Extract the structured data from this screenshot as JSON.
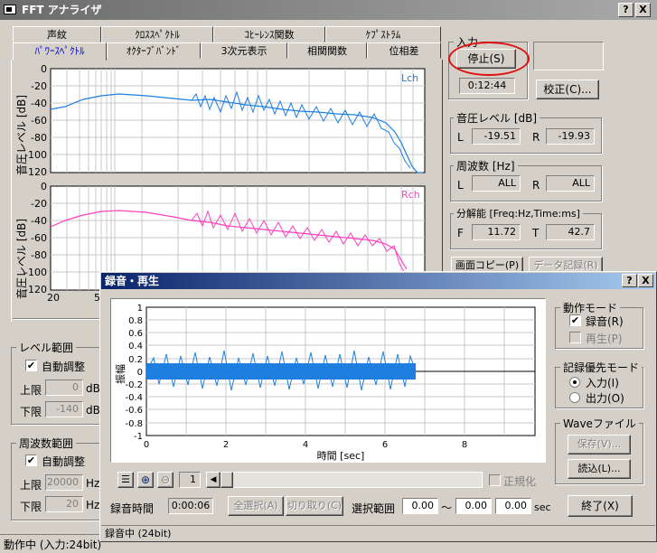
{
  "main_window": {
    "title": "FFT アナライザ",
    "help": "?",
    "close": "X"
  },
  "tabs_row1": [
    "声紋",
    "ｸﾛｽｽﾍﾟｸﾄﾙ",
    "ｺﾋｰﾚﾝｽ関数",
    "ｹﾌﾟｽﾄﾗﾑ"
  ],
  "tabs_row2": [
    "ﾊﾟﾜｰｽﾍﾟｸﾄﾙ",
    "ｵｸﾀｰﾌﾞﾊﾞﾝﾄﾞ",
    "3次元表示",
    "相関関数",
    "位相差"
  ],
  "chart_data": [
    {
      "type": "line",
      "ylabel": "音圧レベル [dB]",
      "yticks": [
        "0",
        "-20",
        "-40",
        "-60",
        "-80",
        "-100",
        "-120"
      ],
      "ylim": [
        -120,
        0
      ],
      "series": [
        {
          "name": "Lch",
          "color": "#1e7fe0"
        }
      ],
      "description_points": [
        [
          20,
          -48
        ],
        [
          60,
          -27
        ],
        [
          500,
          -42
        ],
        [
          5000,
          -48
        ],
        [
          10000,
          -68
        ],
        [
          15000,
          -120
        ]
      ]
    },
    {
      "type": "line",
      "ylabel": "音圧レベル [dB]",
      "yticks": [
        "0",
        "-20",
        "-40",
        "-60",
        "-80",
        "-100",
        "-120"
      ],
      "xticks": [
        "20",
        "5"
      ],
      "ylim": [
        -120,
        0
      ],
      "series": [
        {
          "name": "Rch",
          "color": "#ff40c0"
        }
      ],
      "description_points": [
        [
          20,
          -47
        ],
        [
          60,
          -32
        ],
        [
          500,
          -48
        ],
        [
          5000,
          -60
        ],
        [
          10000,
          -65
        ],
        [
          15000,
          -100
        ]
      ]
    },
    {
      "type": "line",
      "title": "",
      "xlabel": "時間 [sec]",
      "ylabel": "振幅",
      "xticks": [
        "0",
        "2",
        "4",
        "6",
        "8"
      ],
      "yticks": [
        "1",
        "0.8",
        "0.6",
        "0.4",
        "0.2",
        "0",
        "-0.2",
        "-0.4",
        "-0.6",
        "-0.8",
        "-1"
      ],
      "xlim": [
        0,
        10
      ],
      "ylim": [
        -1,
        1
      ],
      "series": [
        {
          "name": "waveform",
          "color": "#1e7fe0",
          "duration_sec": 6.7
        }
      ]
    }
  ],
  "input_panel": {
    "group": "入力",
    "stop_label": "停止(S)",
    "time": "0:12:44",
    "calibrate": "校正(C)..."
  },
  "sound_level": {
    "group": "音圧レベル [dB]",
    "l_label": "L",
    "l_value": "-19.51",
    "r_label": "R",
    "r_value": "-19.93"
  },
  "frequency": {
    "group": "周波数 [Hz]",
    "l_label": "L",
    "l_value": "ALL",
    "r_label": "R",
    "r_value": "ALL"
  },
  "resolution": {
    "group": "分解能 [Freq:Hz,Time:ms]",
    "f_label": "F",
    "f_value": "11.72",
    "t_label": "T",
    "t_value": "42.7"
  },
  "screen_copy": "画面コピー(P)",
  "data_record": "データ記録(R)",
  "level_range": {
    "group": "レベル範囲",
    "auto": "自動調整",
    "upper": "上限",
    "upper_val": "0",
    "lower": "下限",
    "lower_val": "-140",
    "unit": "dB"
  },
  "freq_range": {
    "group": "周波数範囲",
    "auto": "自動調整",
    "upper": "上限",
    "upper_val": "20000",
    "lower": "下限",
    "lower_val": "20",
    "unit": "Hz"
  },
  "main_status": "動作中 (入力:24bit)",
  "dialog": {
    "title": "録音・再生",
    "help": "?",
    "close": "X",
    "zoom_value": "1",
    "normalize": "正規化",
    "rec_time_label": "録音時間",
    "rec_time": "0:00:06",
    "select_all": "全選択(A)",
    "cut": "切り取り(C)",
    "sel_range_label": "選択範囲",
    "sel_start": "0.00",
    "tilde": "〜",
    "sel_end": "0.00",
    "sel_len": "0.00",
    "sec": "sec",
    "mode_group": "動作モード",
    "record": "録音(R)",
    "play": "再生(P)",
    "priority_group": "記録優先モード",
    "input": "入力(I)",
    "output": "出力(O)",
    "wave_group": "Waveファイル",
    "save": "保存(V)...",
    "load": "読込(L)...",
    "quit": "終了(X)",
    "status": "録音中 (24bit)"
  }
}
